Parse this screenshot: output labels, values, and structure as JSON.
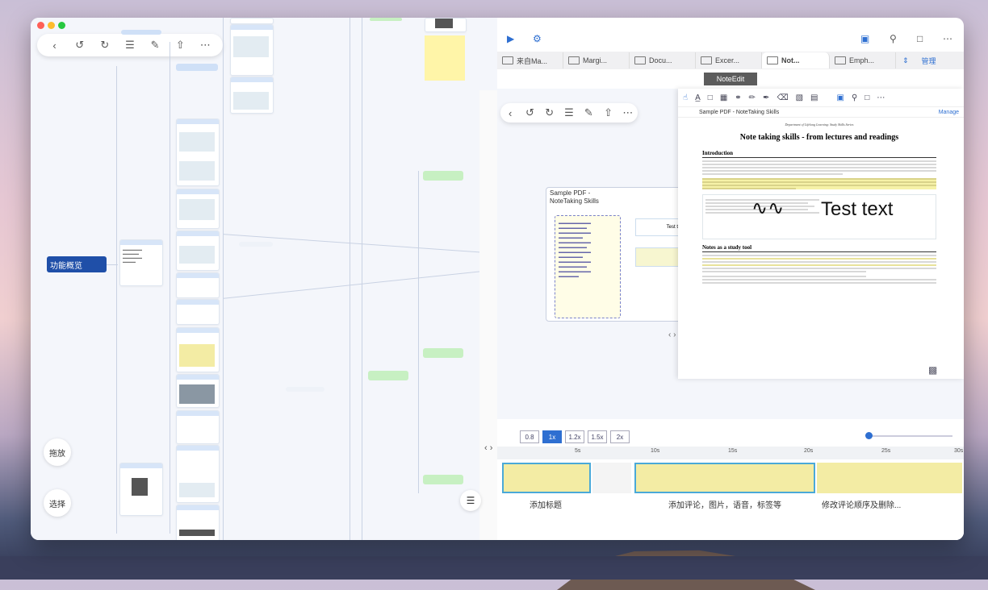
{
  "left_panel": {
    "root_label": "功能概览",
    "drag_label": "拖放",
    "select_label": "选择"
  },
  "right_panel": {
    "tabs": [
      {
        "label": "来自Ma..."
      },
      {
        "label": "Margi..."
      },
      {
        "label": "Docu..."
      },
      {
        "label": "Excer..."
      },
      {
        "label": "Not..."
      },
      {
        "label": "Emph..."
      }
    ],
    "manage_label": "管理",
    "noteedit_label": "NoteEdit",
    "inner_node_title": "Sample PDF - NoteTaking Skills",
    "pdf": {
      "doc_title": "Sample PDF - NoteTaking Skills",
      "manage_label": "Manage",
      "header_small": "Department of Lifelong Learning: Study Skills Series",
      "title": "Note taking skills - from lectures and readings",
      "section1": "Introduction",
      "section2": "Notes as a study tool",
      "handwriting": "Test text",
      "inner_test": "Test t"
    },
    "speeds": [
      "0.8",
      "1x",
      "1.2x",
      "1.5x",
      "2x"
    ],
    "active_speed": "1x",
    "ruler_ticks": [
      "5s",
      "10s",
      "15s",
      "20s",
      "25s",
      "30s"
    ],
    "clip_labels": [
      "添加标题",
      "添加评论，图片，语音，标签等",
      "修改评论顺序及删除..."
    ]
  },
  "colors": {
    "root_node": "#1f4fa8",
    "accent": "#2e6fd1",
    "clip": "#f3eca4",
    "clip_selected_border": "#4aa9d8"
  }
}
